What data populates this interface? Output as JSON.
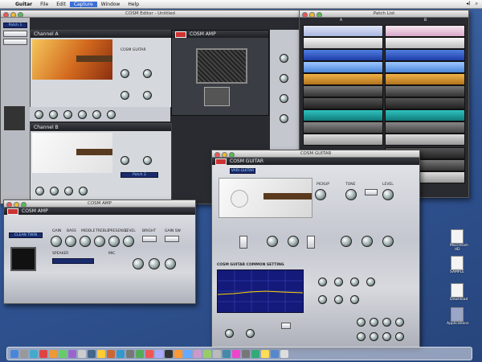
{
  "menubar": {
    "app_name": "Guitar",
    "items": [
      "File",
      "Edit",
      "Capture",
      "Window",
      "Help"
    ],
    "active_index": 2
  },
  "back_window": {
    "title": "COSM Editor - Untitled",
    "channel_a": "Channel A",
    "channel_b": "Channel B",
    "amp_label": "COSM AMP",
    "guitar_label": "COSM GUITAR",
    "lcd_a": "Patch 1",
    "lcd_b": "Patch 2"
  },
  "rack_window": {
    "title": "Patch List",
    "left_col_label": "A",
    "right_col_label": "B"
  },
  "cosm_amp": {
    "title": "COSM AMP",
    "header": "COSM AMP",
    "knob_labels": [
      "GAIN",
      "BASS",
      "MIDDLE",
      "TREBLE",
      "PRESENCE",
      "LEVEL"
    ],
    "amp_type": "CLEAN TWIN",
    "speaker_label": "SPEAKER",
    "mic_label": "MIC",
    "switch_labels": [
      "BRIGHT",
      "GAIN SW"
    ]
  },
  "cosm_guitar": {
    "title": "COSM GUITAR",
    "header": "COSM GUITAR",
    "type_value": "VARI GUITAR",
    "eq_section": "COSM GUITAR COMMON SETTING",
    "pickup_label": "PICKUP",
    "tone_label": "TONE",
    "level_label": "LEVEL"
  },
  "desktop_icons": [
    {
      "name": "Macintosh HD"
    },
    {
      "name": "SAMPLE"
    },
    {
      "name": "Download"
    },
    {
      "name": "Applications"
    }
  ],
  "colors": {
    "desktop": "#2f5290",
    "lcd_bg": "#1a2b6e",
    "scope_bg": "#141a7a",
    "accent_red": "#cc3333"
  }
}
